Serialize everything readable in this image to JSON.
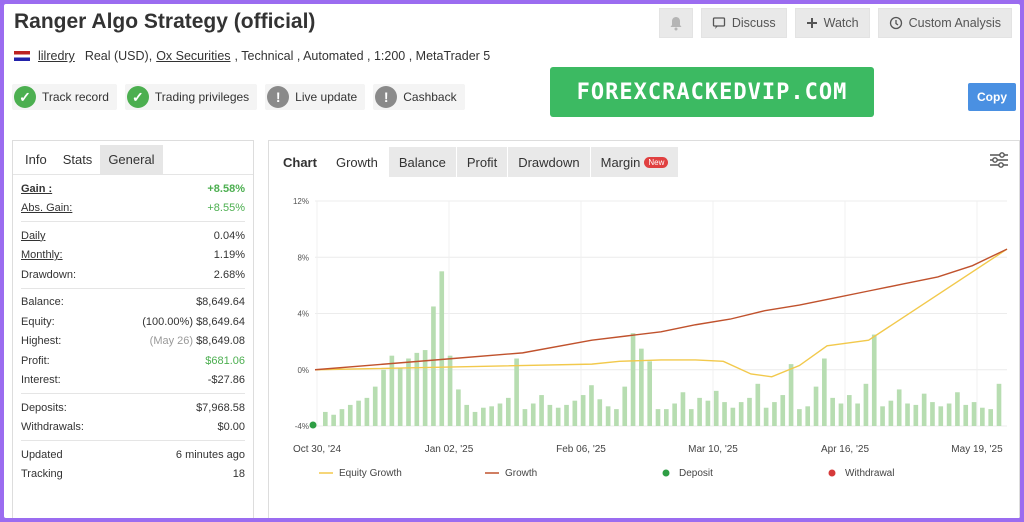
{
  "header": {
    "title": "Ranger Algo Strategy (official)"
  },
  "actions": {
    "discuss": "Discuss",
    "watch": "Watch",
    "custom": "Custom Analysis"
  },
  "meta": {
    "user": "lilredry",
    "account": "Real (USD),",
    "broker": "Ox Securities",
    "rest": ", Technical , Automated , 1:200 , MetaTrader 5"
  },
  "badges": [
    "Track record",
    "Trading privileges",
    "Live update",
    "Cashback"
  ],
  "watermark": "FOREXCRACKEDVIP.COM",
  "copy": "Copy",
  "left_tabs": [
    "Info",
    "Stats",
    "General"
  ],
  "stats": {
    "gain": {
      "label": "Gain :",
      "value": "+8.58%"
    },
    "abs_gain": {
      "label": "Abs. Gain:",
      "value": "+8.55%"
    },
    "daily": {
      "label": "Daily",
      "value": "0.04%"
    },
    "monthly": {
      "label": "Monthly:",
      "value": "1.19%"
    },
    "drawdown": {
      "label": "Drawdown:",
      "value": "2.68%"
    },
    "balance": {
      "label": "Balance:",
      "value": "$8,649.64"
    },
    "equity": {
      "label": "Equity:",
      "note": "(100.00%)",
      "value": "$8,649.64"
    },
    "highest": {
      "label": "Highest:",
      "note": "(May 26)",
      "value": "$8,649.08"
    },
    "profit": {
      "label": "Profit:",
      "value": "$681.06"
    },
    "interest": {
      "label": "Interest:",
      "value": "-$27.86"
    },
    "deposits": {
      "label": "Deposits:",
      "value": "$7,968.58"
    },
    "withdrawals": {
      "label": "Withdrawals:",
      "value": "$0.00"
    },
    "updated": {
      "label": "Updated",
      "value": "6 minutes ago"
    },
    "tracking": {
      "label": "Tracking",
      "value": "18"
    }
  },
  "chart_tabs": {
    "label": "Chart",
    "items": [
      "Growth",
      "Balance",
      "Profit",
      "Drawdown",
      "Margin"
    ],
    "new_badge": "New"
  },
  "colors": {
    "equity": "#f2c94c",
    "growth": "#c0522d",
    "deposit": "#2e9e44",
    "withdrawal": "#d63a3a",
    "bars": "#b7ddb1"
  },
  "chart_data": {
    "type": "line",
    "ylim": [
      -4,
      12
    ],
    "yticks": [
      "12%",
      "8%",
      "4%",
      "0%",
      "-4%"
    ],
    "xticks": [
      "Oct 30, '24",
      "Jan 02, '25",
      "Feb 06, '25",
      "Mar 10, '25",
      "Apr 16, '25",
      "May 19, '25"
    ],
    "series": [
      {
        "name": "Equity Growth",
        "x": [
          0,
          40,
          44,
          50,
          55,
          59,
          63,
          66,
          70,
          74,
          80,
          100
        ],
        "y": [
          0,
          0.4,
          0.6,
          0.7,
          0.7,
          0.6,
          -0.3,
          -0.5,
          0.3,
          1.7,
          2.1,
          8.58
        ]
      },
      {
        "name": "Growth",
        "x": [
          0,
          10,
          20,
          30,
          40,
          45,
          50,
          55,
          60,
          65,
          70,
          75,
          80,
          85,
          90,
          95,
          100
        ],
        "y": [
          0,
          0.4,
          0.8,
          1.2,
          2.1,
          2.4,
          2.7,
          3.2,
          3.6,
          4.2,
          4.6,
          5.1,
          5.6,
          6.1,
          6.6,
          7.4,
          8.58
        ]
      }
    ],
    "bars": [
      1,
      0.8,
      1.2,
      1.5,
      1.8,
      2,
      2.8,
      4,
      5,
      4.1,
      4.8,
      5.2,
      5.4,
      8.5,
      11,
      5,
      2.6,
      1.5,
      1,
      1.3,
      1.4,
      1.6,
      2,
      4.8,
      1.2,
      1.6,
      2.2,
      1.5,
      1.3,
      1.5,
      1.8,
      2.2,
      2.9,
      1.9,
      1.4,
      1.2,
      2.8,
      6.6,
      5.5,
      4.6,
      1.2,
      1.2,
      1.6,
      2.4,
      1.2,
      2,
      1.8,
      2.5,
      1.7,
      1.3,
      1.7,
      2,
      3,
      1.3,
      1.7,
      2.2,
      4.4,
      1.2,
      1.4,
      2.8,
      4.8,
      2,
      1.6,
      2.2,
      1.6,
      3,
      6.5,
      1.4,
      1.8,
      2.6,
      1.6,
      1.5,
      2.3,
      1.7,
      1.4,
      1.6,
      2.4,
      1.5,
      1.7,
      1.3,
      1.2,
      3
    ],
    "legend": [
      "Equity Growth",
      "Growth",
      "Deposit",
      "Withdrawal"
    ]
  }
}
